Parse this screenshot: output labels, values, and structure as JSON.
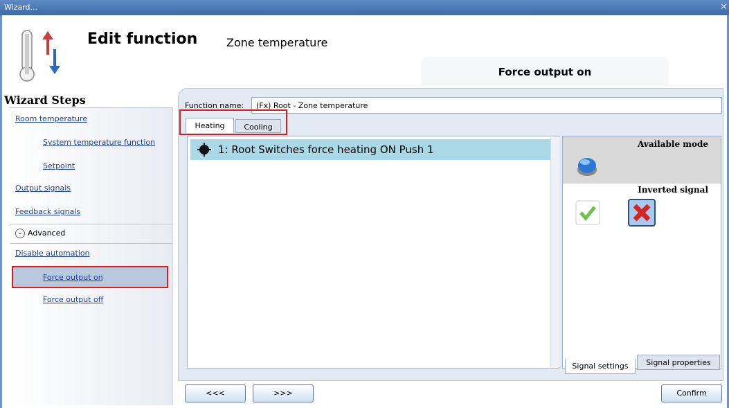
{
  "window": {
    "title": "Wizard..."
  },
  "header": {
    "title": "Edit function",
    "subtitle": "Zone temperature",
    "section": "Force output on"
  },
  "steps": {
    "title": "Wizard Steps",
    "items": [
      {
        "label": "Room temperature"
      },
      {
        "label": "System temperature function"
      },
      {
        "label": "Setpoint"
      },
      {
        "label": "Output signals"
      },
      {
        "label": "Feedback signals"
      }
    ],
    "advanced_label": "Advanced",
    "advanced_items": [
      {
        "label": "Disable automation"
      },
      {
        "label": "Force output on"
      },
      {
        "label": "Force output off"
      }
    ]
  },
  "form": {
    "function_name_label": "Function name:",
    "function_name_value": "(Fx) Root - Zone temperature",
    "tabs": [
      {
        "label": "Heating"
      },
      {
        "label": "Cooling"
      }
    ],
    "signals": [
      {
        "label": "1: Root Switches force heating ON Push 1"
      }
    ]
  },
  "right_panel": {
    "available_mode_label": "Available mode",
    "inverted_signal_label": "Inverted signal",
    "tabs": [
      {
        "label": "Signal settings"
      },
      {
        "label": "Signal properties"
      }
    ]
  },
  "buttons": {
    "prev": "<<<",
    "next": ">>>",
    "confirm": "Confirm"
  },
  "icons": {
    "thermometer": "thermometer-updown-icon",
    "push_button": "push-button-icon",
    "mode_button": "blue-button-icon",
    "check": "green-check-icon",
    "cross": "red-cross-icon"
  },
  "colors": {
    "highlight_red": "#e01b1b",
    "selection_blue": "#a9d8e7",
    "link_blue": "#1a3ea8"
  }
}
